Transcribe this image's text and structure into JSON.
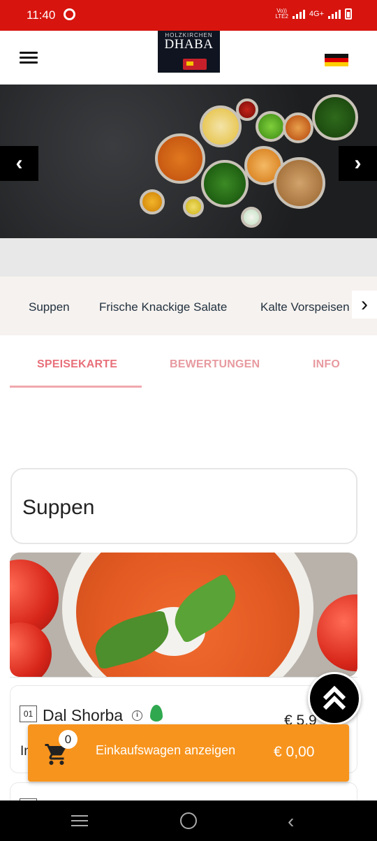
{
  "status_bar": {
    "time": "11:40",
    "carrier_top": "Vo))",
    "carrier_bottom": "LTE2",
    "network": "4G+"
  },
  "header": {
    "logo_top": "HOLZKIRCHEN",
    "logo_main": "DHABA",
    "language_flag": "german-flag",
    "menu_icon": "hamburger-menu-icon"
  },
  "banner": {
    "prev_icon": "chevron-left-icon",
    "next_icon": "chevron-right-icon",
    "prev_glyph": "‹",
    "next_glyph": "›"
  },
  "categories": {
    "items": [
      "Suppen",
      "Frische Knackige Salate",
      "Kalte Vorspeisen"
    ],
    "next_glyph": "›"
  },
  "tabs": [
    {
      "label": "SPEISEKARTE",
      "active": true
    },
    {
      "label": "BEWERTUNGEN",
      "active": false
    },
    {
      "label": "INFO",
      "active": false
    }
  ],
  "menu": {
    "section_title": "Suppen",
    "items": [
      {
        "number": "01",
        "name": "Dal Shorba",
        "price": "€ 5,9",
        "description": "In"
      }
    ]
  },
  "cart": {
    "count": "0",
    "label": "Einkaufswagen anzeigen",
    "total": "€ 0,00"
  },
  "colors": {
    "status_bar": "#d7140e",
    "tab_active": "#e8707a",
    "cart_bar": "#f7941d"
  }
}
